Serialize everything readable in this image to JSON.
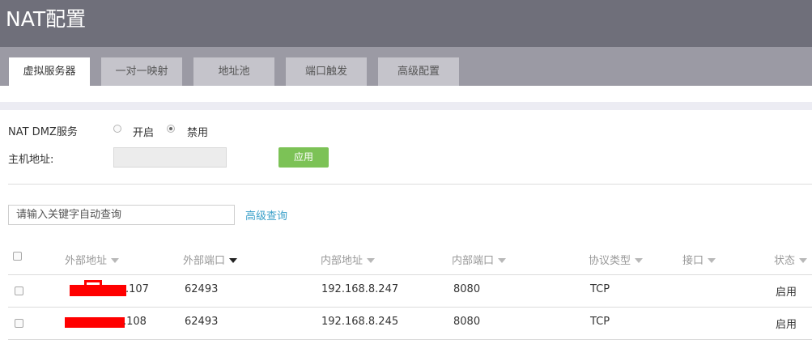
{
  "header": {
    "title": "NAT配置"
  },
  "tabs": [
    {
      "label": "虚拟服务器",
      "active": true
    },
    {
      "label": "一对一映射",
      "active": false
    },
    {
      "label": "地址池",
      "active": false
    },
    {
      "label": "端口触发",
      "active": false
    },
    {
      "label": "高级配置",
      "active": false
    }
  ],
  "dmz": {
    "label": "NAT DMZ服务",
    "option_on": "开启",
    "option_off": "禁用",
    "selected": "禁用",
    "host_label": "主机地址:",
    "host_value": "",
    "apply_label": "应用"
  },
  "search": {
    "placeholder": "请输入关键字自动查询",
    "advanced_label": "高级查询"
  },
  "table": {
    "columns": [
      "外部地址",
      "外部端口",
      "内部地址",
      "内部端口",
      "协议类型",
      "接口",
      "状态"
    ],
    "sorted_column": "外部端口",
    "rows": [
      {
        "ext_addr_suffix": ".107",
        "ext_port": "62493",
        "int_addr": "192.168.8.247",
        "int_port": "8080",
        "protocol": "TCP",
        "interface": "",
        "status": "启用"
      },
      {
        "ext_addr_suffix": ".108",
        "ext_port": "62493",
        "int_addr": "192.168.8.245",
        "int_port": "8080",
        "protocol": "TCP",
        "interface": "",
        "status": "启用"
      }
    ]
  },
  "colors": {
    "header": "#6f6f7a",
    "tabbar": "#9b9aa4",
    "apply": "#7cc256",
    "link": "#3aa0c9",
    "redaction": "#ff0000"
  }
}
